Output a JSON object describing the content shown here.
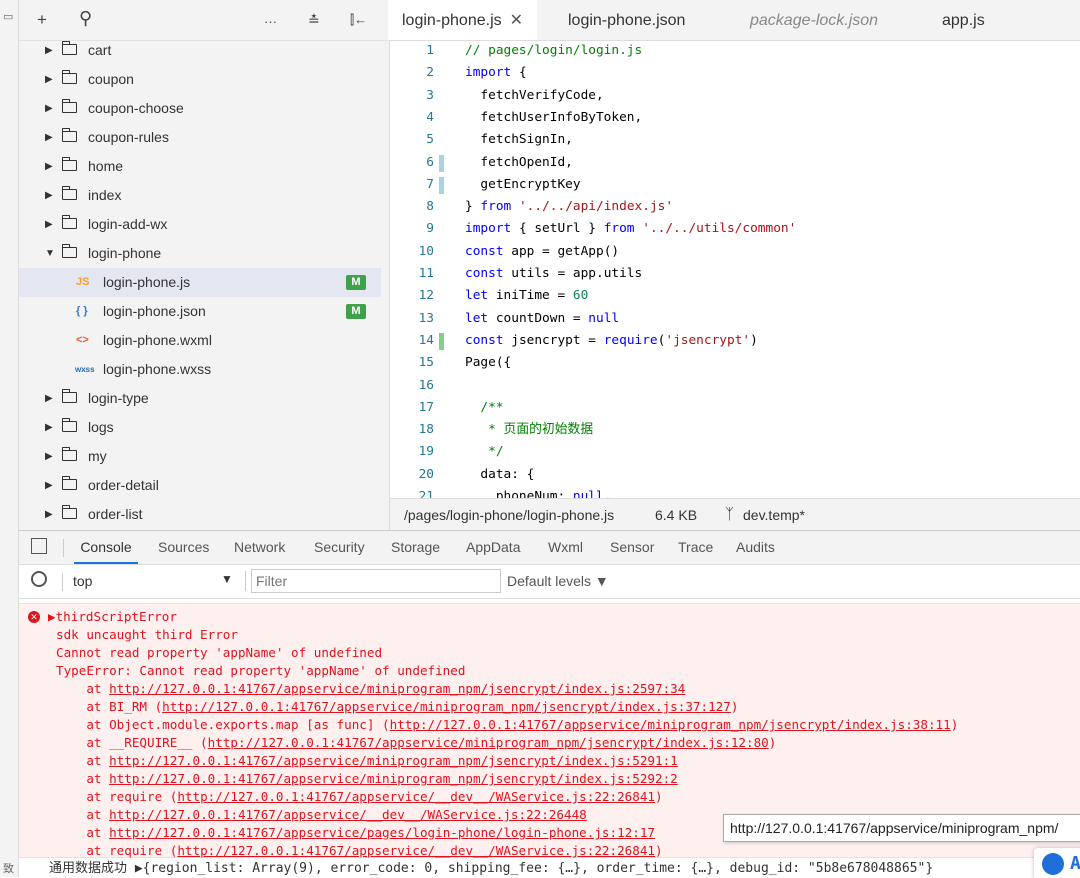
{
  "explorer": {
    "toolbar": {
      "add": "+",
      "search": "⚲",
      "more": "···",
      "collapse": "≛",
      "split": "⫿←"
    },
    "items": [
      {
        "label": "cart",
        "type": "folder",
        "expanded": false
      },
      {
        "label": "coupon",
        "type": "folder",
        "expanded": false
      },
      {
        "label": "coupon-choose",
        "type": "folder",
        "expanded": false
      },
      {
        "label": "coupon-rules",
        "type": "folder",
        "expanded": false
      },
      {
        "label": "home",
        "type": "folder",
        "expanded": false
      },
      {
        "label": "index",
        "type": "folder",
        "expanded": false
      },
      {
        "label": "login-add-wx",
        "type": "folder",
        "expanded": false
      },
      {
        "label": "login-phone",
        "type": "folder",
        "expanded": true
      },
      {
        "label": "login-phone.js",
        "type": "file",
        "icon": "JS",
        "badge": "M",
        "selected": true
      },
      {
        "label": "login-phone.json",
        "type": "file",
        "icon": "{ }",
        "badge": "M"
      },
      {
        "label": "login-phone.wxml",
        "type": "file",
        "icon": "<>"
      },
      {
        "label": "login-phone.wxss",
        "type": "file",
        "icon": "wxss"
      },
      {
        "label": "login-type",
        "type": "folder",
        "expanded": false
      },
      {
        "label": "logs",
        "type": "folder",
        "expanded": false
      },
      {
        "label": "my",
        "type": "folder",
        "expanded": false
      },
      {
        "label": "order-detail",
        "type": "folder",
        "expanded": false
      },
      {
        "label": "order-list",
        "type": "folder",
        "expanded": false
      }
    ]
  },
  "editor": {
    "tabs": [
      {
        "label": "login-phone.js",
        "active": true,
        "close": "✕"
      },
      {
        "label": "login-phone.json"
      },
      {
        "label": "package-lock.json",
        "italic": true
      },
      {
        "label": "app.js"
      }
    ],
    "lines": [
      {
        "n": "1",
        "html": "<span class='cm'>// pages/login/login.js</span>"
      },
      {
        "n": "2",
        "html": "<span class='kw'>import</span> {"
      },
      {
        "n": "3",
        "html": "  fetchVerifyCode,"
      },
      {
        "n": "4",
        "html": "  fetchUserInfoByToken,"
      },
      {
        "n": "5",
        "html": "  fetchSignIn,"
      },
      {
        "n": "6",
        "html": "  fetchOpenId,",
        "gutter": "#a9d2e4"
      },
      {
        "n": "7",
        "html": "  getEncryptKey",
        "gutter": "#a9d2e4"
      },
      {
        "n": "8",
        "html": "} <span class='kw'>from</span> <span class='str'>'../../api/index.js'</span>"
      },
      {
        "n": "9",
        "html": "<span class='kw'>import</span> { setUrl } <span class='kw'>from</span> <span class='str'>'../../utils/common'</span>"
      },
      {
        "n": "10",
        "html": "<span class='kw'>const</span> app = getApp()"
      },
      {
        "n": "11",
        "html": "<span class='kw'>const</span> utils = app.utils"
      },
      {
        "n": "12",
        "html": "<span class='kw'>let</span> iniTime = <span class='num'>60</span>"
      },
      {
        "n": "13",
        "html": "<span class='kw'>let</span> countDown = <span class='kw'>null</span>"
      },
      {
        "n": "14",
        "html": "<span class='kw'>const</span> jsencrypt = <span class='kw'>require</span>(<span class='str'>'jsencrypt'</span>)",
        "gutter": "#7fd18b"
      },
      {
        "n": "15",
        "html": "Page({"
      },
      {
        "n": "16",
        "html": ""
      },
      {
        "n": "17",
        "html": "  <span class='cm'>/**</span>"
      },
      {
        "n": "18",
        "html": "  <span class='cm'> * 页面的初始数据</span>"
      },
      {
        "n": "19",
        "html": "  <span class='cm'> */</span>"
      },
      {
        "n": "20",
        "html": "  data: {"
      },
      {
        "n": "21",
        "html": "    phoneNum: <span class='kw'>null</span>,"
      }
    ],
    "status": {
      "path": "/pages/login-phone/login-phone.js",
      "size": "6.4 KB",
      "branch": "dev.temp*"
    }
  },
  "devtools": {
    "tabs": [
      "Console",
      "Sources",
      "Network",
      "Security",
      "Storage",
      "AppData",
      "Wxml",
      "Sensor",
      "Trace",
      "Audits"
    ],
    "context": "top",
    "filter_placeholder": "Filter",
    "levels": "Default levels ▼",
    "error": {
      "title": "thirdScriptError",
      "lines": [
        "sdk uncaught third Error",
        "Cannot read property 'appName' of undefined",
        "TypeError: Cannot read property 'appName' of undefined"
      ],
      "stack": [
        {
          "pre": "    at ",
          "url": "http://127.0.0.1:41767/appservice/miniprogram_npm/jsencrypt/index.js:2597:34",
          "post": ""
        },
        {
          "pre": "    at BI_RM (",
          "url": "http://127.0.0.1:41767/appservice/miniprogram_npm/jsencrypt/index.js:37:127",
          "post": ")"
        },
        {
          "pre": "    at Object.module.exports.map [as func] (",
          "url": "http://127.0.0.1:41767/appservice/miniprogram_npm/jsencrypt/index.js:38:11",
          "post": ")"
        },
        {
          "pre": "    at __REQUIRE__ (",
          "url": "http://127.0.0.1:41767/appservice/miniprogram_npm/jsencrypt/index.js:12:80",
          "post": ")"
        },
        {
          "pre": "    at ",
          "url": "http://127.0.0.1:41767/appservice/miniprogram_npm/jsencrypt/index.js:5291:1",
          "post": ""
        },
        {
          "pre": "    at ",
          "url": "http://127.0.0.1:41767/appservice/miniprogram_npm/jsencrypt/index.js:5292:2",
          "post": ""
        },
        {
          "pre": "    at require (",
          "url": "http://127.0.0.1:41767/appservice/__dev__/WAService.js:22:26841",
          "post": ")"
        },
        {
          "pre": "    at ",
          "url": "http://127.0.0.1:41767/appservice/__dev__/WAService.js:22:26448",
          "post": ""
        },
        {
          "pre": "    at ",
          "url": "http://127.0.0.1:41767/appservice/pages/login-phone/login-phone.js:12:17",
          "post": ""
        },
        {
          "pre": "    at require (",
          "url": "http://127.0.0.1:41767/appservice/__dev__/WAService.js:22:26841",
          "post": ")"
        }
      ]
    },
    "tooltip": "http://127.0.0.1:41767/appservice/miniprogram_npm/",
    "log_line": "通用数据成功 ▶{region_list: Array(9), error_code: 0, shipping_fee: {…}, order_time: {…}, debug_id: \"5b8e678048865\"}"
  },
  "colors": {
    "error_text": "#e0141e",
    "error_bg": "#fff0f0",
    "badge_green": "#3fa14a",
    "accent_blue": "#1a73e8"
  }
}
